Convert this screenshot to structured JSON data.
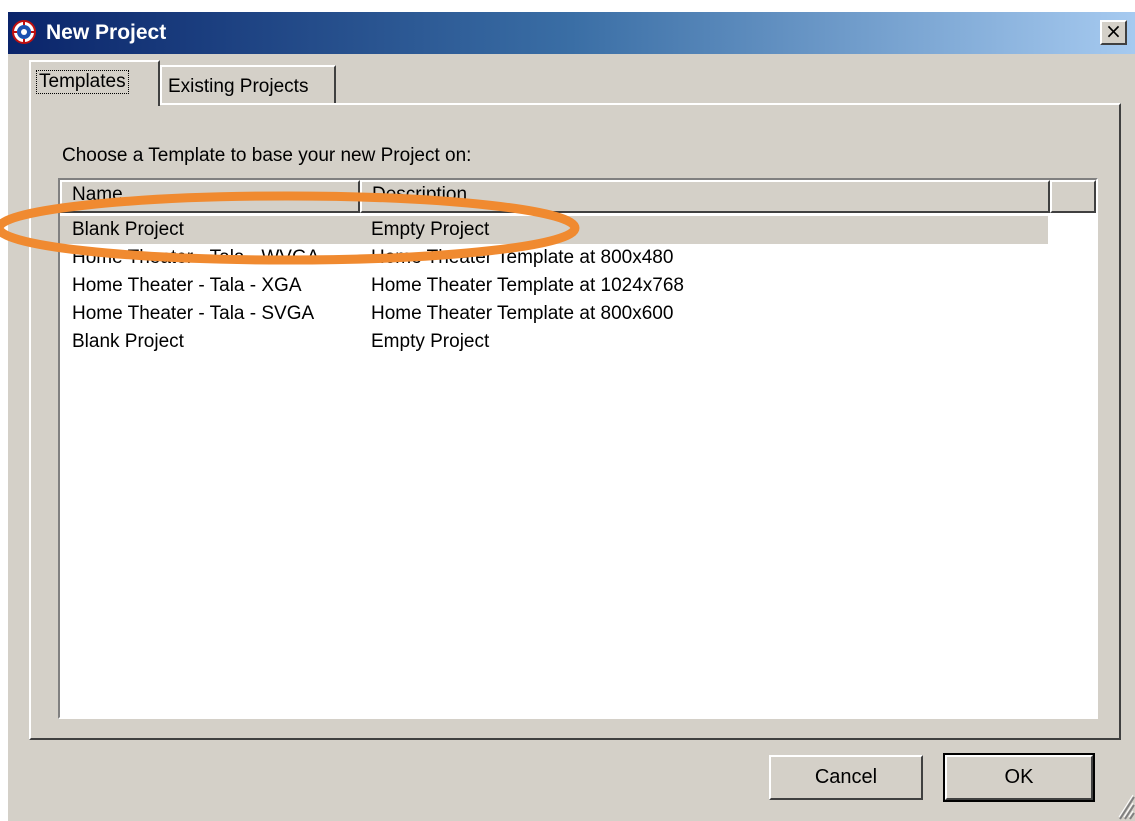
{
  "window": {
    "title": "New Project",
    "close_label": "×"
  },
  "tabs": [
    {
      "label": "Templates"
    },
    {
      "label": "Existing Projects"
    }
  ],
  "panel": {
    "instruction": "Choose a Template to base your new Project on:"
  },
  "list": {
    "columns": [
      "Name",
      "Description"
    ],
    "rows": [
      {
        "name": "Blank Project",
        "description": "Empty Project",
        "selected": true
      },
      {
        "name": "Home Theater - Tala - WVGA",
        "description": "Home Theater Template at 800x480"
      },
      {
        "name": "Home Theater - Tala - XGA",
        "description": "Home Theater Template at 1024x768"
      },
      {
        "name": "Home Theater - Tala - SVGA",
        "description": "Home Theater Template at 800x600"
      },
      {
        "name": "Blank Project",
        "description": "Empty Project"
      }
    ]
  },
  "buttons": {
    "cancel": "Cancel",
    "ok": "OK"
  },
  "colors": {
    "dialog_face": "#d4d0c8",
    "title_start": "#0a246a",
    "title_end": "#a6caf0",
    "annotation": "#f08a30"
  },
  "icons": {
    "app": "app-logo-icon",
    "close": "close-icon",
    "grip": "resize-grip-icon"
  }
}
